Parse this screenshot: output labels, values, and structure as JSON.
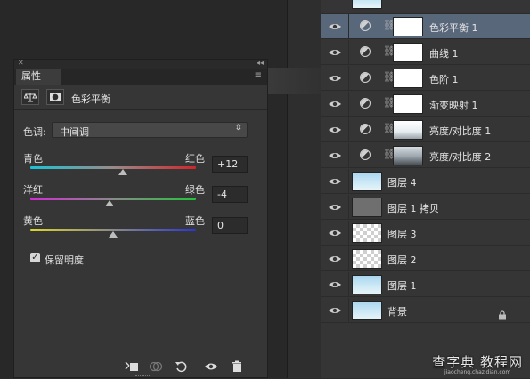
{
  "properties_panel": {
    "close_glyph": "✕",
    "collapse_glyph": "◂◂",
    "tab_label": "属性",
    "menu_glyph": "≡",
    "title": "色彩平衡",
    "tone": {
      "label": "色调:",
      "selected": "中间调"
    },
    "sliders": [
      {
        "left_label": "青色",
        "right_label": "红色",
        "value_text": "+12",
        "value": 12,
        "min": -100,
        "max": 100
      },
      {
        "left_label": "洋红",
        "right_label": "绿色",
        "value_text": "-4",
        "value": -4,
        "min": -100,
        "max": 100
      },
      {
        "left_label": "黄色",
        "right_label": "蓝色",
        "value_text": "0",
        "value": 0,
        "min": -100,
        "max": 100
      }
    ],
    "preserve_luminosity": {
      "label": "保留明度",
      "checked": true
    }
  },
  "layers": [
    {
      "name": "色彩平衡 1",
      "kind": "adjustment",
      "selected": true
    },
    {
      "name": "曲线 1",
      "kind": "adjustment"
    },
    {
      "name": "色阶 1",
      "kind": "adjustment"
    },
    {
      "name": "渐变映射 1",
      "kind": "adjustment"
    },
    {
      "name": "亮度/对比度 1",
      "kind": "adjustment-photo"
    },
    {
      "name": "亮度/对比度 2",
      "kind": "adjustment-photo-dark"
    },
    {
      "name": "图层 4",
      "kind": "image-sky"
    },
    {
      "name": "图层 1 拷贝",
      "kind": "image-gray"
    },
    {
      "name": "图层 3",
      "kind": "image-transparent"
    },
    {
      "name": "图层 2",
      "kind": "image-transparent"
    },
    {
      "name": "图层 1",
      "kind": "image-sky"
    },
    {
      "name": "背景",
      "kind": "background",
      "locked": true
    }
  ],
  "watermark": {
    "main": "查字典 教程网",
    "sub": "jiaocheng.chazidian.com"
  },
  "colors": {
    "selected_row": "#59677b",
    "panel_bg": "#363636",
    "layers_bg": "#353535"
  }
}
